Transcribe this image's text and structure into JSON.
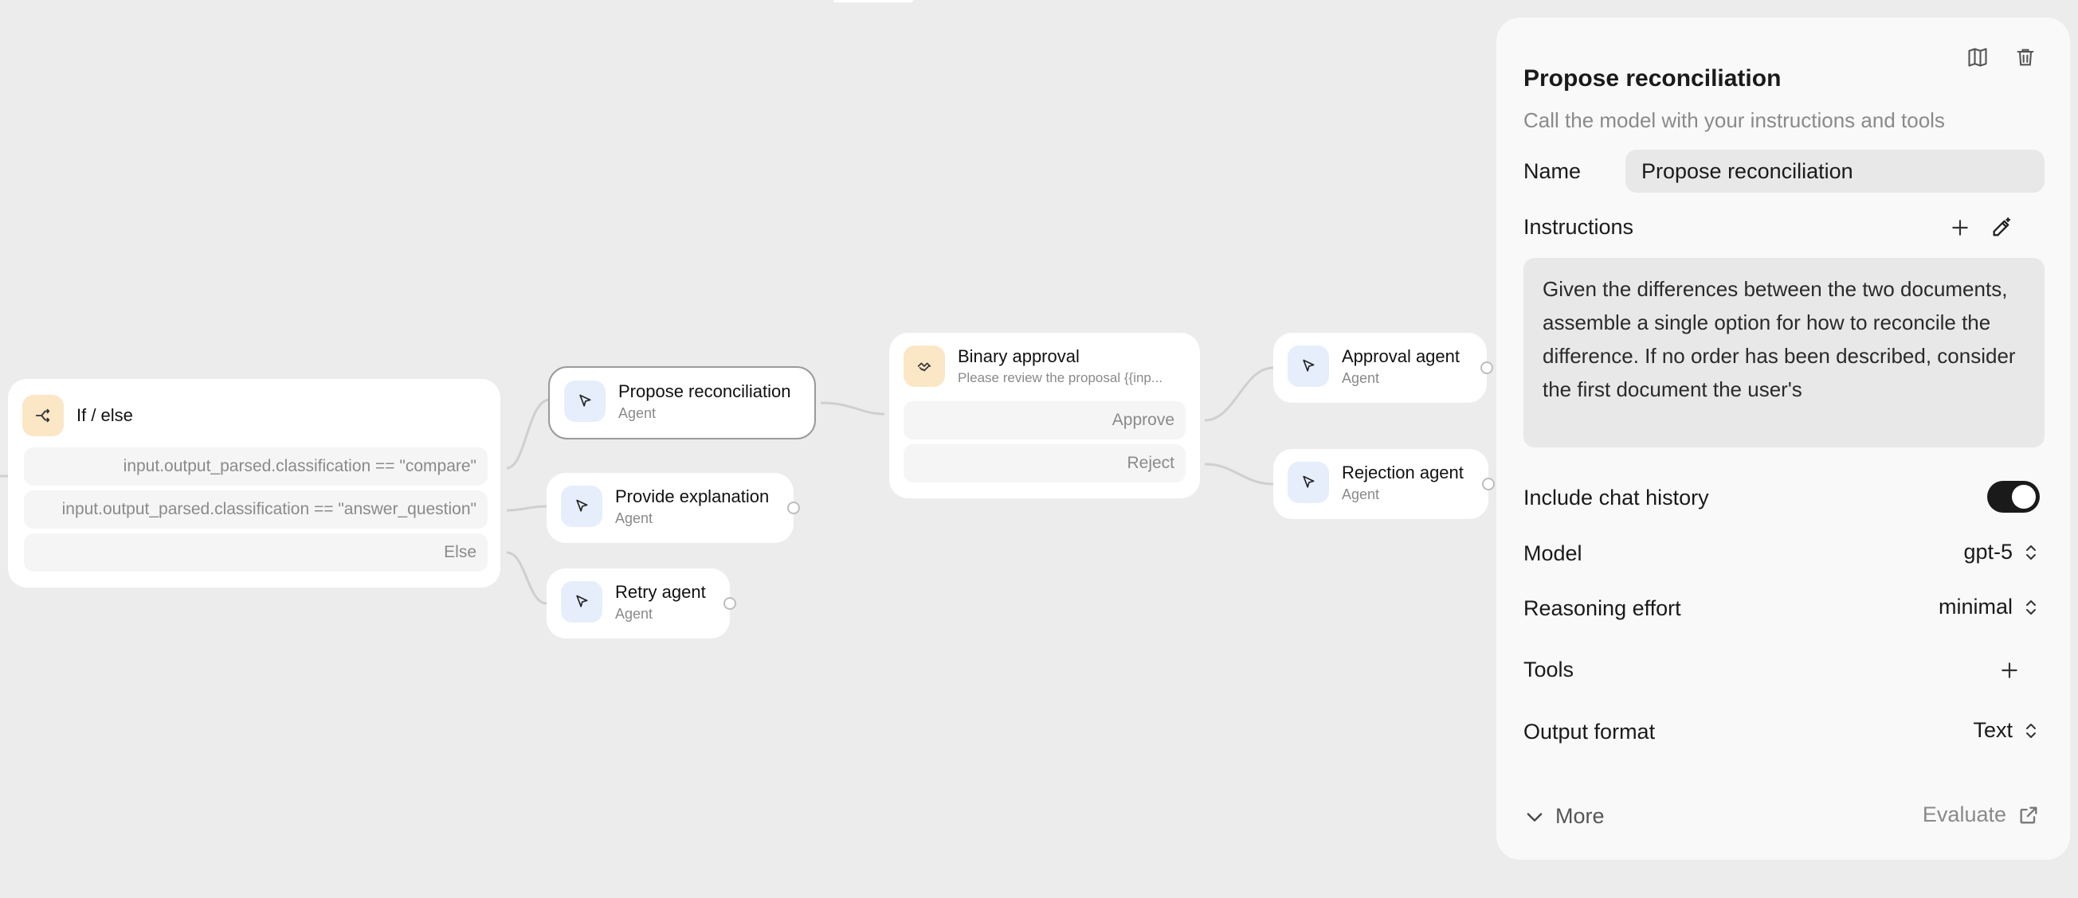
{
  "canvas": {
    "if_else": {
      "title": "If / else",
      "conditions": [
        "input.output_parsed.classification == \"compare\"",
        "input.output_parsed.classification == \"answer_question\"",
        "Else"
      ]
    },
    "agent_nodes": {
      "propose": {
        "title": "Propose reconciliation",
        "subtitle": "Agent"
      },
      "explain": {
        "title": "Provide explanation",
        "subtitle": "Agent"
      },
      "retry": {
        "title": "Retry agent",
        "subtitle": "Agent"
      },
      "approval": {
        "title": "Approval agent",
        "subtitle": "Agent"
      },
      "rejection": {
        "title": "Rejection agent",
        "subtitle": "Agent"
      }
    },
    "binary_approval": {
      "title": "Binary approval",
      "subtitle": "Please review the proposal {{inp...",
      "options": [
        "Approve",
        "Reject"
      ]
    }
  },
  "panel": {
    "title": "Propose reconciliation",
    "description": "Call the model with your instructions and tools",
    "name_label": "Name",
    "name_value": "Propose reconciliation",
    "instructions_label": "Instructions",
    "instructions_text": "Given the differences between the two documents, assemble a single option for how to reconcile the difference. If no order has been described, consider the first document the user's",
    "chat_history_label": "Include chat history",
    "chat_history_enabled": true,
    "model_label": "Model",
    "model_value": "gpt-5",
    "reasoning_label": "Reasoning effort",
    "reasoning_value": "minimal",
    "tools_label": "Tools",
    "output_label": "Output format",
    "output_value": "Text",
    "more_label": "More",
    "evaluate_label": "Evaluate"
  },
  "colors": {
    "canvas_bg": "#ececec",
    "agent_icon_bg": "#e6eefc",
    "logic_icon_bg": "#fbe6c6",
    "toggle_on": "#1a1a1a"
  },
  "icons": {
    "agent": "cursor-arrow-icon",
    "if_else": "branch-icon",
    "approval": "hands-icon",
    "docs": "book-icon",
    "delete": "trash-icon",
    "add": "plus-icon",
    "ai_edit": "magic-pen-icon"
  }
}
